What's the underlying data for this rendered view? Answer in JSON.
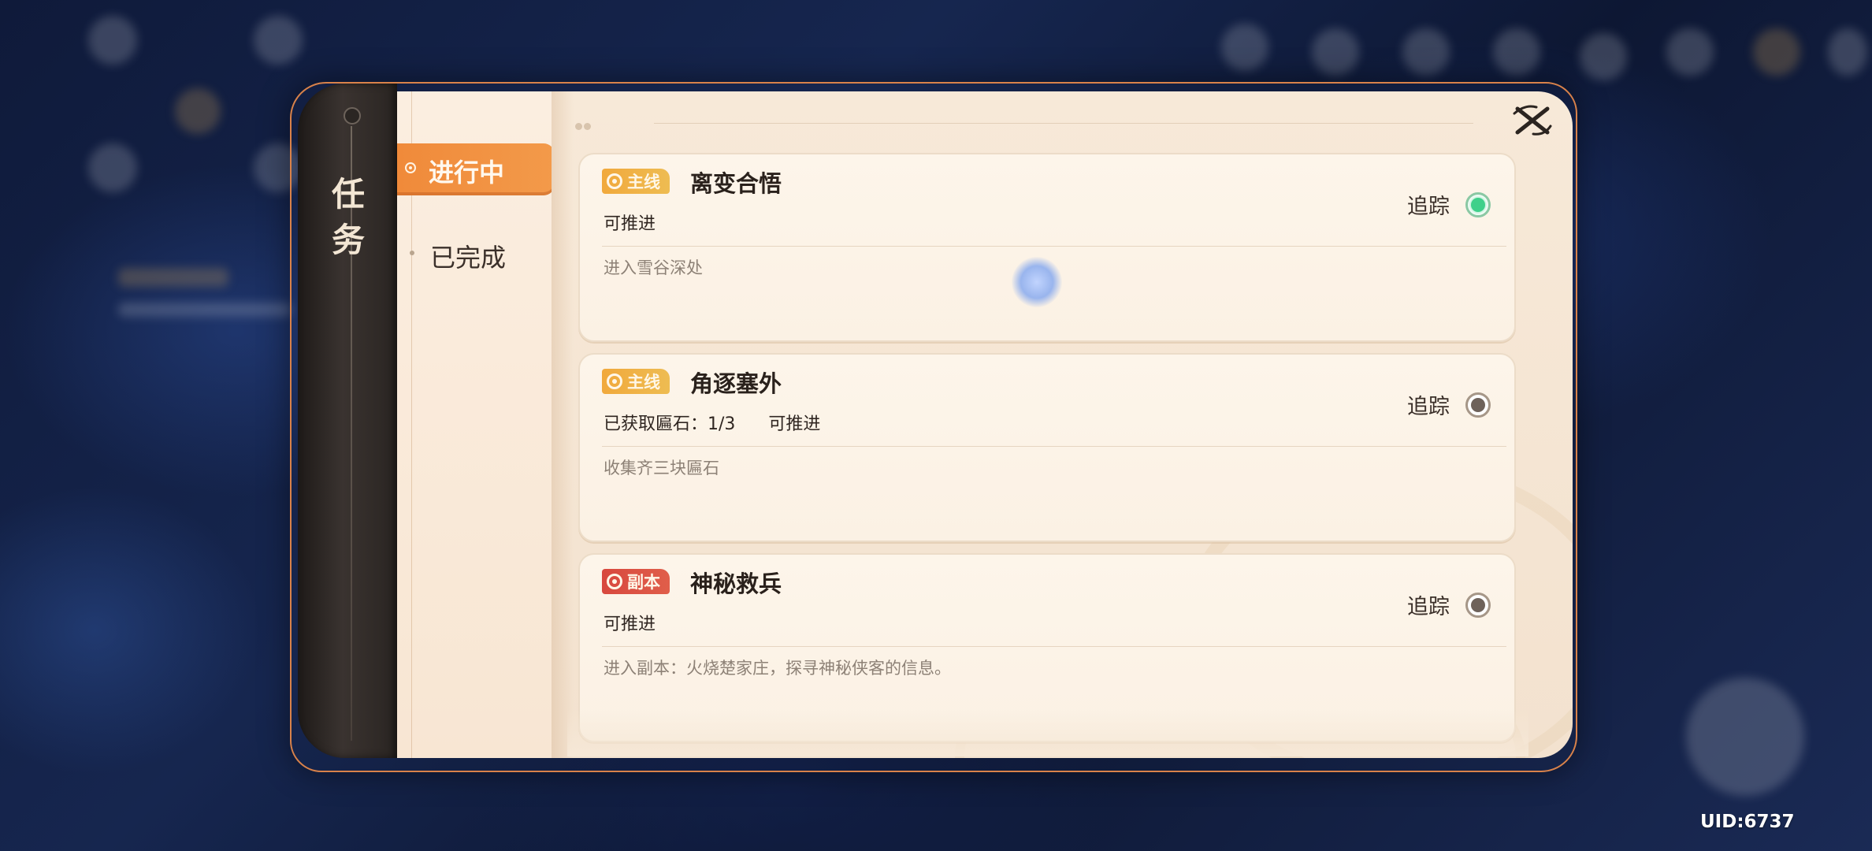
{
  "panel": {
    "title": "任务",
    "close_icon": "close-icon"
  },
  "tabs": [
    {
      "label": "进行中",
      "active": true
    },
    {
      "label": "已完成",
      "active": false
    }
  ],
  "quests": [
    {
      "badge": "主线",
      "badge_color": "#f1a93c",
      "title": "离变合悟",
      "status": "可推进",
      "description": "进入雪谷深处",
      "track_label": "追踪",
      "tracked": true
    },
    {
      "badge": "主线",
      "badge_color": "#f1a93c",
      "title": "角逐塞外",
      "status": "已获取匾石：1/3      可推进",
      "description": "收集齐三块匾石",
      "track_label": "追踪",
      "tracked": false
    },
    {
      "badge": "副本",
      "badge_color": "#d8483e",
      "title": "神秘救兵",
      "status": "可推进",
      "description": "进入副本：火烧楚家庄，探寻神秘侠客的信息。",
      "track_label": "追踪",
      "tracked": false
    }
  ],
  "footer": {
    "uid": "UID:6737"
  },
  "colors": {
    "accent": "#f08a3a",
    "tracked_on": "#3fd08a",
    "tracked_off": "#6e625a",
    "panel_bg": "#f7e9d8"
  }
}
